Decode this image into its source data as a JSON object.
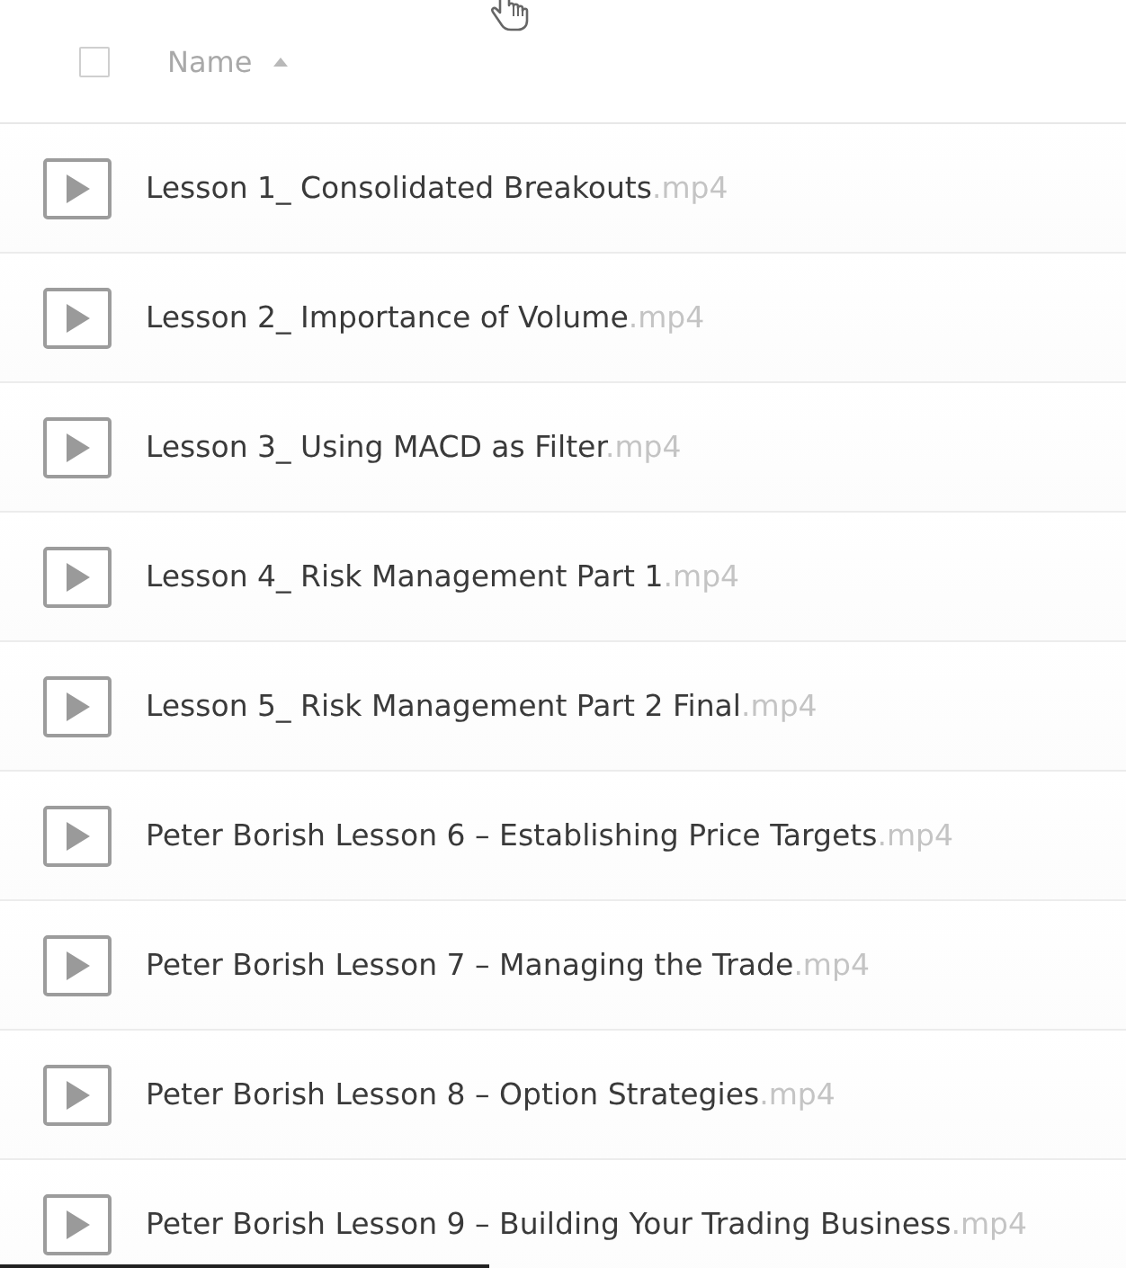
{
  "header": {
    "select_all": {
      "checked": false
    },
    "column": {
      "label": "Name",
      "sorted_ascending": true
    }
  },
  "rows": [
    {
      "name": "Lesson 1_ Consolidated Breakouts",
      "extension": ".mp4"
    },
    {
      "name": "Lesson 2_ Importance of Volume",
      "extension": ".mp4"
    },
    {
      "name": "Lesson 3_ Using MACD as Filter",
      "extension": ".mp4"
    },
    {
      "name": "Lesson 4_ Risk Management Part 1",
      "extension": ".mp4"
    },
    {
      "name": "Lesson 5_ Risk Management Part 2 Final",
      "extension": ".mp4"
    },
    {
      "name": "Peter Borish Lesson 6 – Establishing Price Targets",
      "extension": ".mp4"
    },
    {
      "name": "Peter Borish Lesson 7 – Managing the Trade",
      "extension": ".mp4"
    },
    {
      "name": "Peter Borish Lesson 8 – Option Strategies",
      "extension": ".mp4"
    },
    {
      "name": "Peter Borish Lesson 9 – Building Your Trading Business",
      "extension": ".mp4"
    }
  ]
}
